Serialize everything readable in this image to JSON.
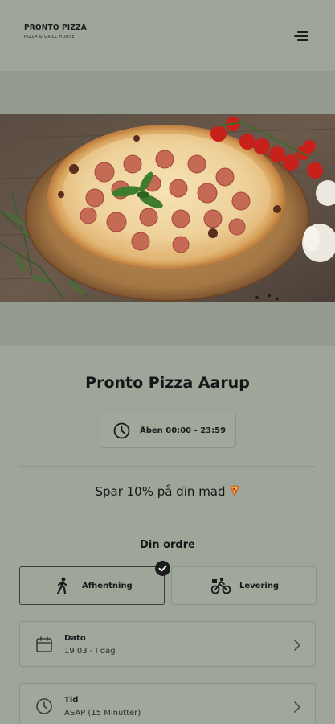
{
  "header": {
    "logo_title": "PRONTO PIZZA",
    "logo_subtitle": "PIZZA & GRILL HOUSE",
    "menu_icon": "menu-icon"
  },
  "hero": {
    "image": "pepperoni pizza on wooden board with tomatoes, basil, garlic and rosemary"
  },
  "restaurant": {
    "name": "Pronto Pizza Aarup",
    "hours_label": "Åben 00:00 - 23:59",
    "hours_icon": "clock-icon"
  },
  "promo": {
    "text": "Spar 10% på din mad",
    "icon": "pizza-slice-icon"
  },
  "order": {
    "heading": "Din ordre",
    "options": [
      {
        "label": "Afhentning",
        "icon": "walking-person-icon",
        "selected": true
      },
      {
        "label": "Levering",
        "icon": "bicycle-courier-icon",
        "selected": false
      }
    ]
  },
  "fields": {
    "date": {
      "label": "Dato",
      "value": "19.03 - I dag",
      "icon": "calendar-icon"
    },
    "time": {
      "label": "Tid",
      "value": "ASAP (15 Minutter)",
      "icon": "clock-icon"
    }
  },
  "colors": {
    "background": "#9ea69a",
    "band": "#949c90",
    "text": "#151515"
  }
}
